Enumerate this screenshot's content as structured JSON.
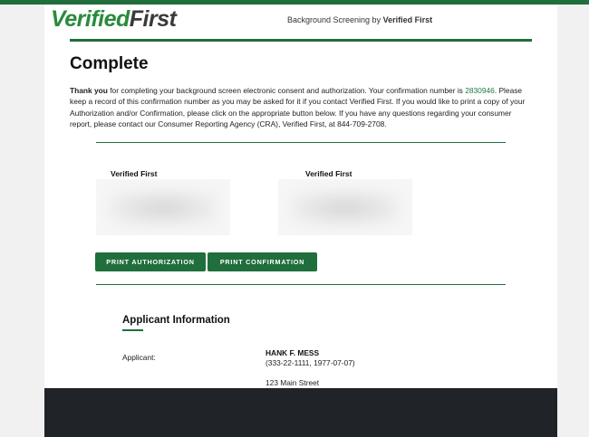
{
  "header": {
    "logo_verified": "Verified",
    "logo_first": "First",
    "tagline_prefix": "Background Screening by ",
    "tagline_brand": "Verified First"
  },
  "page_title": "Complete",
  "message": {
    "bold_lead": "Thank you",
    "text_before_number": " for completing your background screen electronic consent and authorization. Your confirmation number is ",
    "confirmation_number": "2830946",
    "text_after_number": ". Please keep a record of this confirmation number as you may be asked for it if you contact Verified First. If you would like to print a copy of your Authorization and/or Confirmation, please click on the appropriate button below. If you have any questions regarding your consumer report, please contact our Consumer Reporting Agency (CRA), Verified First, at 844-709-2708."
  },
  "signatures": [
    {
      "label": "Verified First"
    },
    {
      "label": "Verified First"
    }
  ],
  "buttons": {
    "print_authorization": "PRINT AUTHORIZATION",
    "print_confirmation": "PRINT CONFIRMATION"
  },
  "applicant_section": {
    "title": "Applicant Information",
    "applicant_label": "Applicant:",
    "name": "HANK F. MESS",
    "details": "(333-22-1111, 1977-07-07)",
    "street": "123 Main Street"
  },
  "colors": {
    "brand_green": "#1f6e3c",
    "logo_green": "#2a8a3c",
    "footer_dark": "#202428"
  }
}
